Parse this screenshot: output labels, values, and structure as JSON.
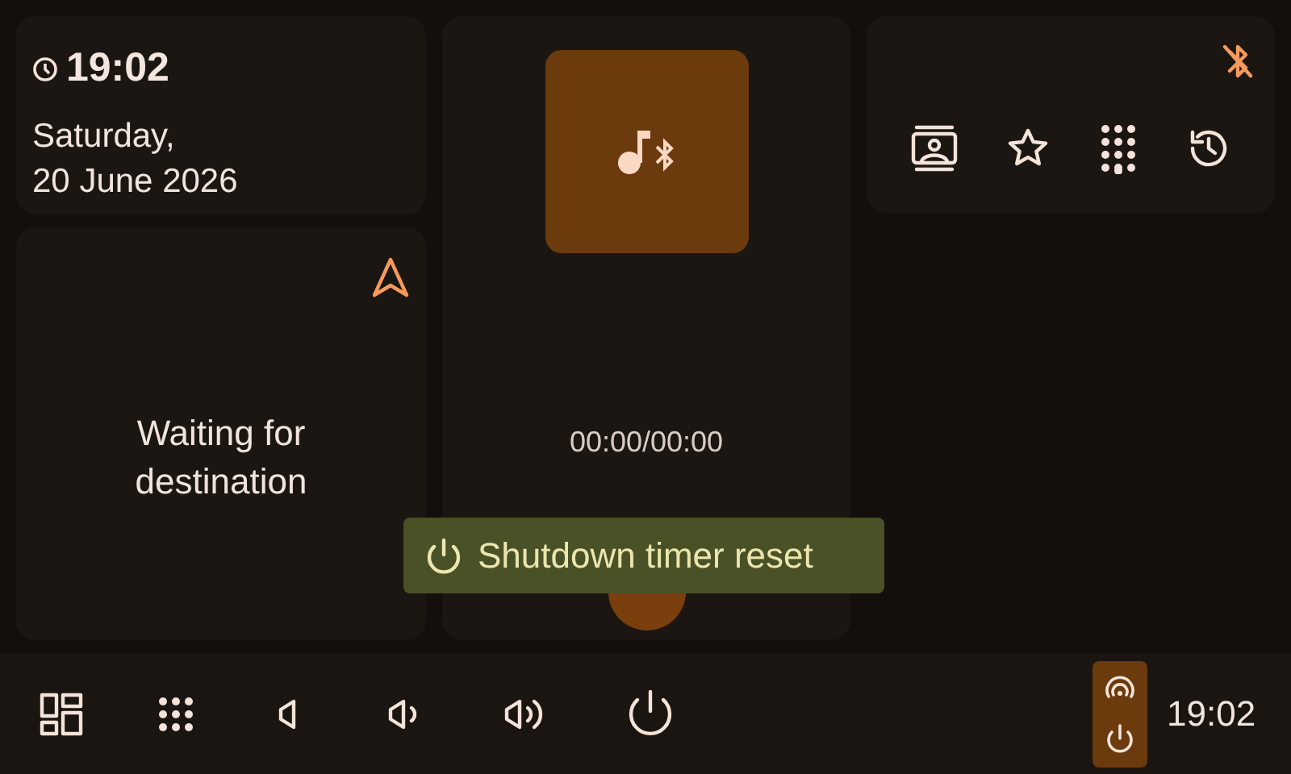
{
  "clock": {
    "time": "19:02",
    "date_lines": [
      "Saturday,",
      "20 June 2026"
    ]
  },
  "navigation": {
    "message": [
      "Waiting for",
      "destination"
    ]
  },
  "media": {
    "time": "00:00/00:00"
  },
  "phone": {
    "bluetooth_connected": false
  },
  "toast": {
    "message": "Shutdown timer reset"
  },
  "status_bar": {
    "time": "19:02"
  }
}
